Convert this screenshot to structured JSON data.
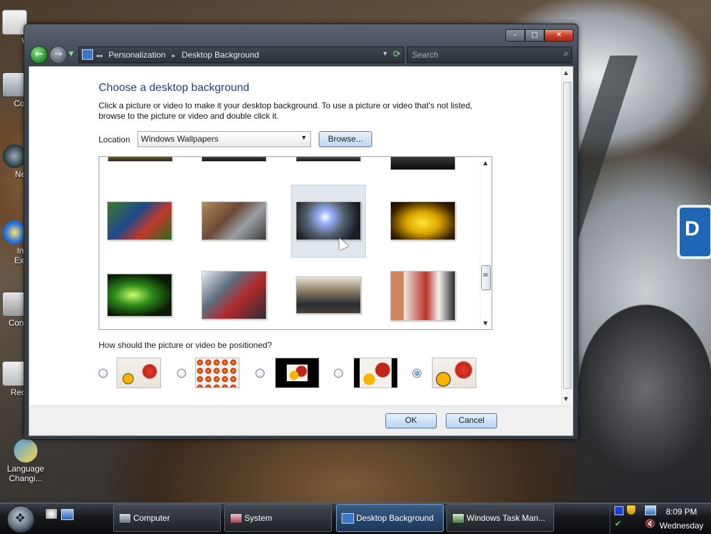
{
  "desktop": {
    "icons": [
      {
        "label": "W",
        "name": "desktop-icon-documents"
      },
      {
        "label": "Con",
        "name": "desktop-icon-computer"
      },
      {
        "label": "Net",
        "name": "desktop-icon-network"
      },
      {
        "label": "Int\nExp",
        "name": "desktop-icon-internet-explorer"
      },
      {
        "label": "Contr",
        "name": "desktop-icon-control-panel"
      },
      {
        "label": "Recy",
        "name": "desktop-icon-recycle-bin"
      },
      {
        "label": "Language Changi...",
        "name": "desktop-icon-language"
      }
    ]
  },
  "window": {
    "controls": {
      "minimize": "–",
      "maximize": "□",
      "close": "✕"
    },
    "address": {
      "crumbs": [
        "Personalization",
        "Desktop Background"
      ],
      "separator": "▸",
      "prefix": "◂◂"
    },
    "search": {
      "placeholder": "Search"
    },
    "title": "Choose a desktop background",
    "description": "Click a picture or video to make it your desktop background. To use a picture or video that's not listed, browse to the picture or video and double click it.",
    "location": {
      "label": "Location",
      "value": "Windows Wallpapers",
      "browse_label": "Browse..."
    },
    "gallery": {
      "selected_index": 2,
      "rows": [
        [
          "Racing cars on grass track",
          "Silver race car on dirt",
          "Silver car with light burst",
          "Yellow sports car"
        ],
        [
          "Green spotlight portrait",
          "Warrior with red cape",
          "Black car on track",
          "Couple beside red sofa"
        ]
      ]
    },
    "position": {
      "question": "How should the picture or video be positioned?",
      "options": [
        "Fit to screen",
        "Tile",
        "Center",
        "Center wide",
        "Stretch"
      ],
      "selected": 4
    },
    "footer": {
      "ok_label": "OK",
      "cancel_label": "Cancel"
    }
  },
  "taskbar": {
    "tasks": [
      {
        "label": "Computer",
        "active": false
      },
      {
        "label": "System",
        "active": false
      },
      {
        "label": "Desktop Background",
        "active": true
      },
      {
        "label": "Windows Task Man...",
        "active": false
      }
    ],
    "clock": {
      "time": "8:09 PM",
      "day": "Wednesday"
    }
  }
}
